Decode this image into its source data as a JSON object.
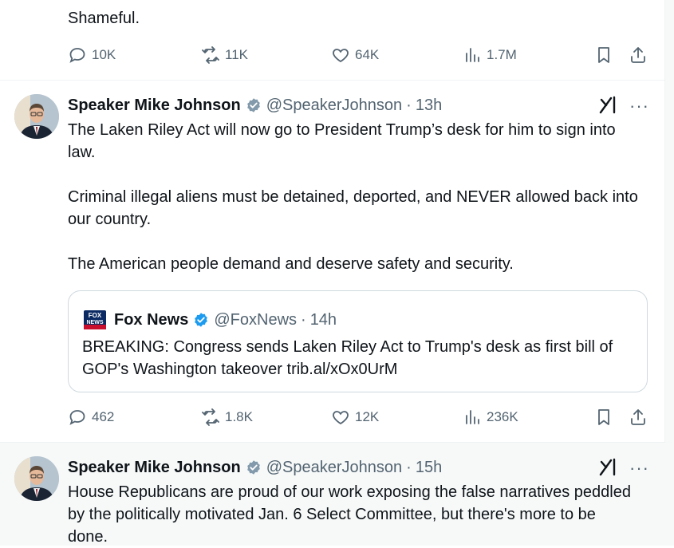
{
  "top_post": {
    "text": "Shameful.",
    "stats": {
      "replies": "10K",
      "reposts": "11K",
      "likes": "64K",
      "views": "1.7M"
    }
  },
  "post1": {
    "author_name": "Speaker Mike Johnson",
    "handle": "@SpeakerJohnson",
    "separator": "·",
    "time": "13h",
    "paragraphs": [
      "The Laken Riley Act will now go to President Trump’s desk for him to sign into law.",
      "Criminal illegal aliens must be detained, deported, and NEVER allowed back into our country.",
      "The American people demand and deserve safety and security."
    ],
    "quote": {
      "logo_text": "FOX NEWS",
      "author_name": "Fox News",
      "handle": "@FoxNews",
      "separator": "·",
      "time": "14h",
      "text": "BREAKING: Congress sends Laken Riley Act to Trump's desk as first bill of GOP's Washington takeover trib.al/xOx0UrM"
    },
    "stats": {
      "replies": "462",
      "reposts": "1.8K",
      "likes": "12K",
      "views": "236K"
    }
  },
  "post2": {
    "author_name": "Speaker Mike Johnson",
    "handle": "@SpeakerJohnson",
    "separator": "·",
    "time": "15h",
    "text": "House Republicans are proud of our work exposing the false narratives peddled by the politically motivated Jan. 6 Select Committee, but there's more to be done."
  },
  "icons": {
    "reply": "reply-icon",
    "repost": "repost-icon",
    "like": "heart-icon",
    "views": "views-icon",
    "bookmark": "bookmark-icon",
    "share": "share-icon",
    "verified": "verified-badge-icon",
    "grok": "grok-icon",
    "more": "more-options-icon"
  },
  "colors": {
    "text_primary": "#0f1419",
    "text_secondary": "#536471",
    "verified_gray": "#829aab",
    "verified_blue": "#1d9bf0",
    "border": "#eff3f4"
  },
  "more_glyph": "···"
}
